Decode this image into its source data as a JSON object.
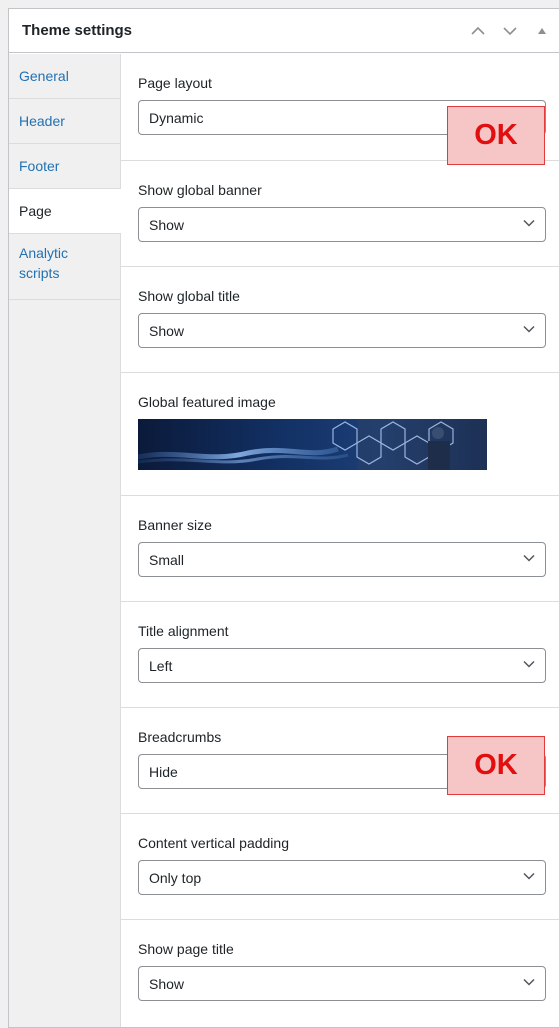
{
  "panel": {
    "title": "Theme settings"
  },
  "tabs": [
    {
      "label": "General"
    },
    {
      "label": "Header"
    },
    {
      "label": "Footer"
    },
    {
      "label": "Page"
    },
    {
      "label": "Analytic scripts"
    }
  ],
  "active_tab": "Page",
  "fields": {
    "page_layout": {
      "label": "Page layout",
      "value": "Dynamic"
    },
    "global_banner": {
      "label": "Show global banner",
      "value": "Show"
    },
    "global_title": {
      "label": "Show global title",
      "value": "Show"
    },
    "featured_image": {
      "label": "Global featured image"
    },
    "banner_size": {
      "label": "Banner size",
      "value": "Small"
    },
    "title_alignment": {
      "label": "Title alignment",
      "value": "Left"
    },
    "breadcrumbs": {
      "label": "Breadcrumbs",
      "value": "Hide"
    },
    "vertical_padding": {
      "label": "Content vertical padding",
      "value": "Only top"
    },
    "page_title": {
      "label": "Show page title",
      "value": "Show"
    }
  },
  "badges": {
    "ok_1": "OK",
    "ok_2": "OK"
  },
  "icons": {
    "move_up": "chevron-up-icon",
    "move_down": "chevron-down-icon",
    "toggle": "triangle-up-icon",
    "select_arrow": "chevron-down-icon"
  },
  "colors": {
    "link": "#2271b1",
    "badge_text": "#e10f0f",
    "badge_bg": "#f6c5c5",
    "badge_border": "#e23b3b"
  }
}
